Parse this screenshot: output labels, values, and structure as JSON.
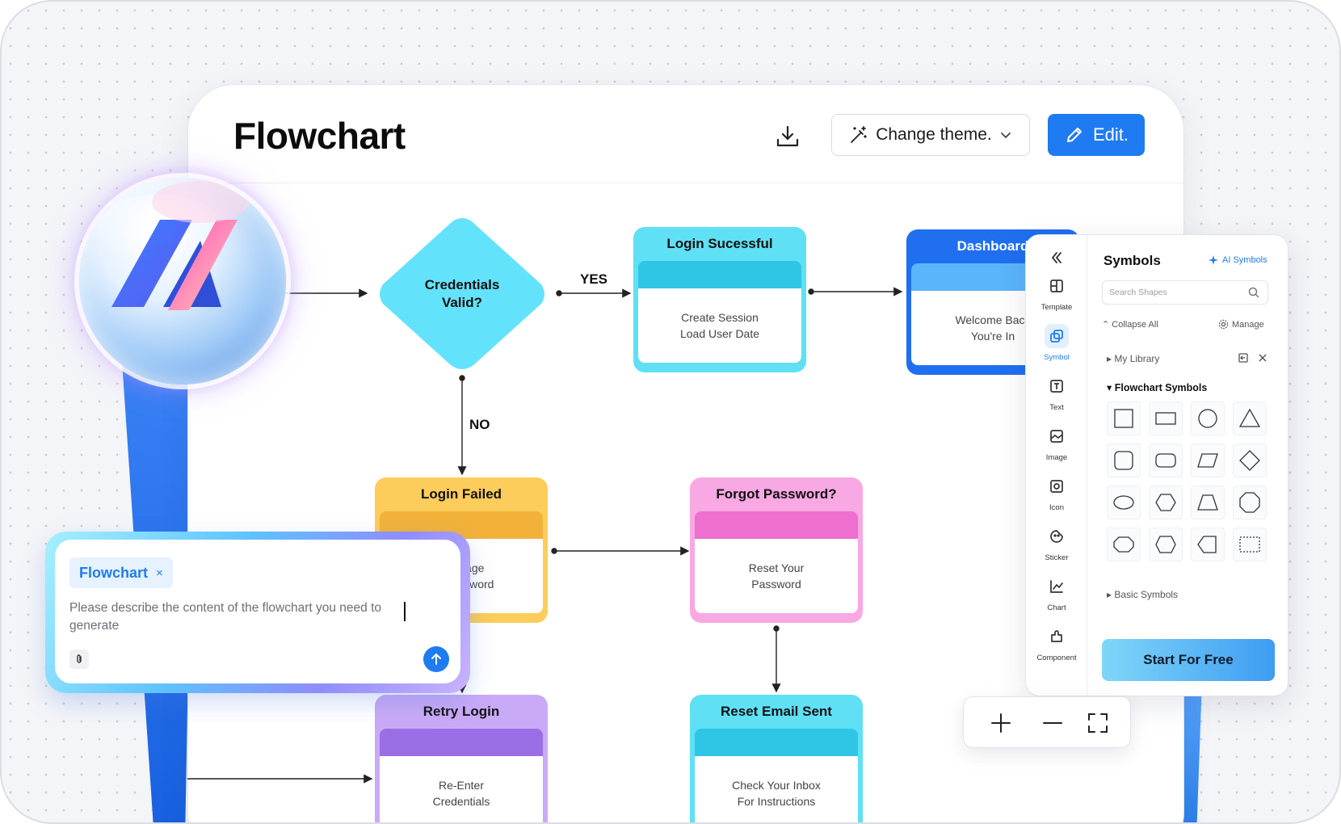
{
  "header": {
    "title": "Flowchart",
    "change_theme_label": "Change theme.",
    "edit_label": "Edit."
  },
  "flowchart": {
    "decision": {
      "line1": "Credentials",
      "line2": "Valid?"
    },
    "edge_yes": "YES",
    "edge_no": "NO",
    "nodes": [
      {
        "title": "Login Sucessful",
        "line1": "Create Session",
        "line2": "Load User Date",
        "color": "#5fe0f5",
        "band": "#2fc6e6"
      },
      {
        "title": "Dashboard",
        "line1": "Welcome Back",
        "line2": "You're In",
        "color": "#1f6ff0",
        "band": "#5ab5fb"
      },
      {
        "title": "Login Failed",
        "line1": "Message",
        "line2": "Or Password",
        "color": "#fccd5a",
        "band": "#f2b23a"
      },
      {
        "title": "Forgot Password?",
        "line1": "Reset Your",
        "line2": "Password",
        "color": "#f8a8e2",
        "band": "#ee6fce"
      },
      {
        "title": "Retry Login",
        "line1": "Re-Enter",
        "line2": "Credentials",
        "color": "#c9aaf6",
        "band": "#9b6ee6"
      },
      {
        "title": "Reset Email Sent",
        "line1": "Check Your Inbox",
        "line2": "For Instructions",
        "color": "#5fe0f5",
        "band": "#2fc6e6"
      }
    ]
  },
  "panel": {
    "rail": [
      "Template",
      "Symbol",
      "Text",
      "Image",
      "Icon",
      "Sticker",
      "Chart",
      "Component"
    ],
    "active_rail": "Symbol",
    "title": "Symbols",
    "ai_symbols": "AI Symbols",
    "search_placeholder": "Search Shapes",
    "collapse_all": "Collapse All",
    "manage": "Manage",
    "my_library": "My Library",
    "flowchart_symbols": "Flowchart Symbols",
    "basic_symbols": "Basic Symbols",
    "start_button": "Start For Free",
    "accent": "#1f7bf2"
  },
  "prompt": {
    "chip": "Flowchart",
    "chip_close": "×",
    "text": "Please describe the content of the flowchart you need to generate"
  }
}
